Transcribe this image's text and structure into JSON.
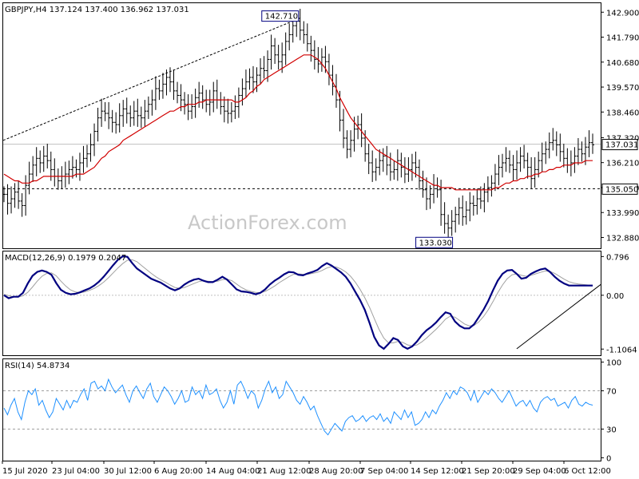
{
  "chart_data": [
    {
      "type": "line",
      "panel": "price",
      "header": "GBPJPY,H4  137.124 137.400 136.962 137.031",
      "watermark": "ActionForex.com",
      "ylim": [
        132.4,
        143.3
      ],
      "yticks": [
        "142.900",
        "141.790",
        "140.680",
        "139.570",
        "138.460",
        "137.320",
        "136.210",
        "135.100",
        "133.990",
        "132.880"
      ],
      "current_price": {
        "value": 137.031,
        "label": "137.031"
      },
      "support": {
        "value": 135.05,
        "label": "135.050"
      },
      "annotations": [
        {
          "label": "142.710",
          "value": 142.71,
          "x_index": 82
        },
        {
          "label": "133.030",
          "value": 133.03,
          "x_index": 120
        }
      ],
      "close": [
        134.8,
        134.4,
        134.6,
        134.9,
        134.5,
        134.3,
        135.2,
        135.7,
        136.1,
        136.4,
        136.2,
        136.5,
        136.3,
        135.9,
        135.6,
        135.4,
        135.6,
        135.7,
        135.9,
        136.0,
        135.9,
        136.2,
        136.4,
        136.6,
        137.0,
        137.6,
        138.2,
        138.5,
        138.4,
        138.2,
        138.0,
        137.9,
        138.3,
        138.6,
        138.4,
        138.2,
        138.5,
        138.3,
        138.2,
        138.5,
        138.8,
        139.0,
        139.5,
        139.4,
        139.7,
        140.0,
        139.8,
        139.4,
        139.2,
        139.0,
        138.8,
        138.5,
        138.7,
        139.1,
        139.3,
        139.0,
        138.8,
        138.9,
        139.4,
        139.0,
        138.7,
        138.5,
        138.4,
        138.5,
        138.7,
        139.2,
        139.5,
        139.8,
        140.0,
        139.8,
        140.1,
        140.4,
        140.3,
        140.8,
        141.4,
        141.0,
        140.7,
        141.0,
        141.6,
        141.9,
        142.3,
        142.5,
        142.1,
        141.9,
        141.5,
        141.2,
        140.8,
        140.6,
        140.9,
        140.7,
        140.1,
        139.6,
        139.0,
        138.1,
        137.3,
        136.8,
        137.2,
        137.7,
        137.9,
        137.3,
        136.6,
        136.2,
        135.8,
        136.0,
        136.3,
        136.5,
        136.1,
        135.8,
        135.9,
        136.3,
        136.0,
        135.7,
        135.9,
        136.2,
        136.0,
        135.4,
        135.0,
        134.6,
        134.8,
        135.2,
        135.0,
        133.9,
        133.5,
        133.3,
        133.6,
        133.9,
        134.2,
        133.8,
        134.1,
        134.4,
        134.3,
        134.6,
        134.5,
        134.9,
        135.1,
        135.3,
        135.7,
        136.0,
        136.2,
        136.4,
        136.1,
        135.9,
        136.2,
        136.5,
        136.3,
        136.0,
        135.5,
        135.9,
        136.3,
        136.6,
        136.8,
        137.1,
        137.2,
        137.0,
        136.7,
        136.4,
        136.1,
        136.2,
        136.5,
        136.8,
        136.6,
        136.9,
        137.1,
        137.0
      ],
      "ma": [
        135.7,
        135.6,
        135.5,
        135.4,
        135.4,
        135.3,
        135.3,
        135.3,
        135.4,
        135.4,
        135.5,
        135.6,
        135.6,
        135.6,
        135.6,
        135.6,
        135.6,
        135.6,
        135.6,
        135.6,
        135.7,
        135.7,
        135.7,
        135.8,
        135.9,
        136.0,
        136.2,
        136.4,
        136.5,
        136.7,
        136.8,
        136.9,
        137.0,
        137.2,
        137.3,
        137.4,
        137.5,
        137.6,
        137.7,
        137.8,
        137.9,
        138.0,
        138.1,
        138.2,
        138.3,
        138.4,
        138.5,
        138.5,
        138.6,
        138.7,
        138.7,
        138.8,
        138.8,
        138.8,
        138.9,
        138.9,
        139.0,
        139.0,
        139.0,
        139.0,
        139.0,
        139.0,
        139.0,
        139.0,
        138.9,
        138.9,
        139.0,
        139.1,
        139.3,
        139.4,
        139.6,
        139.7,
        139.9,
        140.0,
        140.1,
        140.2,
        140.3,
        140.4,
        140.5,
        140.6,
        140.7,
        140.8,
        140.9,
        141.0,
        141.0,
        141.0,
        140.9,
        140.8,
        140.6,
        140.4,
        140.1,
        139.8,
        139.5,
        139.1,
        138.8,
        138.5,
        138.2,
        138.0,
        137.8,
        137.6,
        137.4,
        137.2,
        137.0,
        136.8,
        136.7,
        136.6,
        136.5,
        136.4,
        136.3,
        136.2,
        136.1,
        136.0,
        135.9,
        135.8,
        135.7,
        135.6,
        135.5,
        135.4,
        135.3,
        135.2,
        135.2,
        135.1,
        135.1,
        135.1,
        135.1,
        135.0,
        135.0,
        135.0,
        135.0,
        135.0,
        135.0,
        135.0,
        135.0,
        135.0,
        135.0,
        135.0,
        135.1,
        135.1,
        135.2,
        135.3,
        135.3,
        135.4,
        135.4,
        135.5,
        135.5,
        135.6,
        135.6,
        135.7,
        135.7,
        135.8,
        135.8,
        135.9,
        135.9,
        136.0,
        136.0,
        136.1,
        136.1,
        136.1,
        136.2,
        136.2,
        136.2,
        136.3,
        136.3,
        136.3
      ]
    },
    {
      "type": "line",
      "panel": "macd",
      "header": "MACD(12,26,9) 0.1979 0.2047",
      "ylim": [
        -1.25,
        0.9
      ],
      "yticks": [
        "0.796",
        "0.00",
        "-1.1064"
      ],
      "trendline": {
        "from": [
          108,
          -1.1
        ],
        "to": [
          172,
          0.22
        ]
      },
      "macd": [
        0.0,
        -0.06,
        -0.03,
        -0.03,
        0.05,
        0.24,
        0.4,
        0.48,
        0.51,
        0.48,
        0.42,
        0.25,
        0.11,
        0.05,
        0.02,
        0.03,
        0.06,
        0.1,
        0.14,
        0.2,
        0.28,
        0.38,
        0.5,
        0.62,
        0.73,
        0.8,
        0.79,
        0.66,
        0.55,
        0.48,
        0.41,
        0.34,
        0.3,
        0.26,
        0.2,
        0.14,
        0.1,
        0.14,
        0.22,
        0.28,
        0.32,
        0.34,
        0.3,
        0.27,
        0.27,
        0.32,
        0.38,
        0.32,
        0.22,
        0.12,
        0.08,
        0.07,
        0.05,
        0.02,
        0.05,
        0.12,
        0.22,
        0.3,
        0.36,
        0.43,
        0.48,
        0.47,
        0.42,
        0.41,
        0.45,
        0.48,
        0.52,
        0.6,
        0.66,
        0.61,
        0.54,
        0.47,
        0.38,
        0.24,
        0.07,
        -0.1,
        -0.3,
        -0.57,
        -0.86,
        -1.03,
        -1.1,
        -1.0,
        -0.88,
        -0.92,
        -1.05,
        -1.1,
        -1.05,
        -0.95,
        -0.82,
        -0.72,
        -0.65,
        -0.56,
        -0.45,
        -0.35,
        -0.38,
        -0.54,
        -0.63,
        -0.68,
        -0.68,
        -0.6,
        -0.45,
        -0.3,
        -0.12,
        0.1,
        0.3,
        0.44,
        0.51,
        0.52,
        0.44,
        0.34,
        0.36,
        0.44,
        0.49,
        0.53,
        0.55,
        0.48,
        0.38,
        0.3,
        0.24,
        0.2,
        0.2,
        0.2,
        0.2,
        0.2,
        0.2
      ],
      "signal": [
        0.02,
        -0.01,
        -0.03,
        -0.04,
        -0.01,
        0.06,
        0.17,
        0.29,
        0.39,
        0.45,
        0.46,
        0.4,
        0.29,
        0.19,
        0.11,
        0.07,
        0.05,
        0.07,
        0.1,
        0.14,
        0.2,
        0.27,
        0.36,
        0.46,
        0.56,
        0.65,
        0.72,
        0.73,
        0.69,
        0.61,
        0.53,
        0.45,
        0.38,
        0.32,
        0.27,
        0.21,
        0.16,
        0.14,
        0.16,
        0.2,
        0.24,
        0.28,
        0.3,
        0.29,
        0.28,
        0.29,
        0.32,
        0.33,
        0.3,
        0.23,
        0.16,
        0.11,
        0.08,
        0.06,
        0.05,
        0.08,
        0.13,
        0.19,
        0.26,
        0.32,
        0.38,
        0.43,
        0.44,
        0.43,
        0.43,
        0.45,
        0.47,
        0.51,
        0.56,
        0.59,
        0.58,
        0.54,
        0.48,
        0.39,
        0.27,
        0.12,
        -0.05,
        -0.25,
        -0.48,
        -0.7,
        -0.88,
        -0.98,
        -0.98,
        -0.95,
        -0.97,
        -1.02,
        -1.04,
        -1.02,
        -0.96,
        -0.88,
        -0.79,
        -0.7,
        -0.6,
        -0.49,
        -0.43,
        -0.45,
        -0.52,
        -0.59,
        -0.63,
        -0.62,
        -0.55,
        -0.44,
        -0.3,
        -0.13,
        0.05,
        0.21,
        0.34,
        0.42,
        0.44,
        0.41,
        0.39,
        0.41,
        0.44,
        0.47,
        0.5,
        0.49,
        0.45,
        0.39,
        0.33,
        0.28,
        0.25,
        0.23,
        0.22,
        0.21,
        0.21
      ]
    },
    {
      "type": "line",
      "panel": "rsi",
      "header": "RSI(14) 54.8734",
      "ylim": [
        0,
        100
      ],
      "yticks": [
        "100",
        "70",
        "30",
        "0"
      ],
      "levels": [
        70,
        30
      ],
      "rsi": [
        52,
        45,
        55,
        62,
        48,
        40,
        58,
        70,
        66,
        72,
        55,
        60,
        50,
        42,
        48,
        62,
        56,
        50,
        60,
        52,
        60,
        58,
        66,
        72,
        60,
        78,
        80,
        72,
        75,
        70,
        82,
        74,
        68,
        72,
        76,
        66,
        58,
        70,
        75,
        68,
        62,
        72,
        78,
        64,
        58,
        66,
        74,
        70,
        64,
        56,
        62,
        70,
        58,
        60,
        74,
        66,
        70,
        62,
        76,
        66,
        68,
        72,
        60,
        52,
        58,
        70,
        56,
        76,
        80,
        72,
        62,
        70,
        66,
        52,
        60,
        72,
        80,
        68,
        74,
        62,
        66,
        80,
        74,
        68,
        60,
        56,
        64,
        58,
        50,
        54,
        44,
        36,
        28,
        24,
        30,
        36,
        32,
        28,
        38,
        42,
        44,
        38,
        40,
        44,
        38,
        42,
        44,
        40,
        46,
        38,
        42,
        36,
        48,
        44,
        40,
        50,
        42,
        48,
        34,
        36,
        40,
        48,
        42,
        50,
        46,
        54,
        60,
        68,
        62,
        70,
        66,
        74,
        72,
        68,
        60,
        70,
        58,
        64,
        70,
        66,
        72,
        68,
        62,
        58,
        64,
        70,
        62,
        54,
        58,
        60,
        54,
        60,
        52,
        48,
        58,
        62,
        64,
        60,
        62,
        54,
        56,
        58,
        52,
        60,
        64,
        56,
        54,
        58,
        56,
        55
      ]
    },
    {
      "type": "table",
      "panel": "time-axis",
      "xticks": [
        "15 Jul 2020",
        "23 Jul 04:00",
        "30 Jul 12:00",
        "6 Aug 20:00",
        "14 Aug 04:00",
        "21 Aug 12:00",
        "28 Aug 20:00",
        "7 Sep 04:00",
        "14 Sep 12:00",
        "21 Sep 20:00",
        "29 Sep 04:00",
        "6 Oct 12:00"
      ]
    }
  ]
}
